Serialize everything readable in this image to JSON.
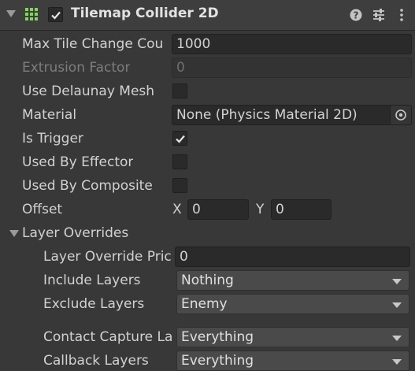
{
  "header": {
    "title": "Tilemap Collider 2D",
    "enabled": true,
    "help_icon": "help-icon",
    "presets_icon": "presets-icon",
    "menu_icon": "kebab-menu-icon"
  },
  "fields": {
    "max_tile_change_count": {
      "label": "Max Tile Change Cou",
      "value": "1000"
    },
    "extrusion_factor": {
      "label": "Extrusion Factor",
      "value": "0"
    },
    "use_delaunay_mesh": {
      "label": "Use Delaunay Mesh",
      "checked": false
    },
    "material": {
      "label": "Material",
      "value": "None (Physics Material 2D)"
    },
    "is_trigger": {
      "label": "Is Trigger",
      "checked": true
    },
    "used_by_effector": {
      "label": "Used By Effector",
      "checked": false
    },
    "used_by_composite": {
      "label": "Used By Composite",
      "checked": false
    },
    "offset": {
      "label": "Offset",
      "x_label": "X",
      "x_value": "0",
      "y_label": "Y",
      "y_value": "0"
    }
  },
  "layer_overrides": {
    "label": "Layer Overrides",
    "expanded": true,
    "priority": {
      "label": "Layer Override Pric",
      "value": "0"
    },
    "include_layers": {
      "label": "Include Layers",
      "value": "Nothing"
    },
    "exclude_layers": {
      "label": "Exclude Layers",
      "value": "Enemy"
    },
    "contact_capture_layers": {
      "label": "Contact Capture La",
      "value": "Everything"
    },
    "callback_layers": {
      "label": "Callback Layers",
      "value": "Everything"
    }
  },
  "colors": {
    "background": "#383838",
    "header": "#3e3e3e",
    "field_bg": "#2a2a2a",
    "dropdown_bg": "#4a4a4a",
    "component_icon": "#7ed957"
  }
}
